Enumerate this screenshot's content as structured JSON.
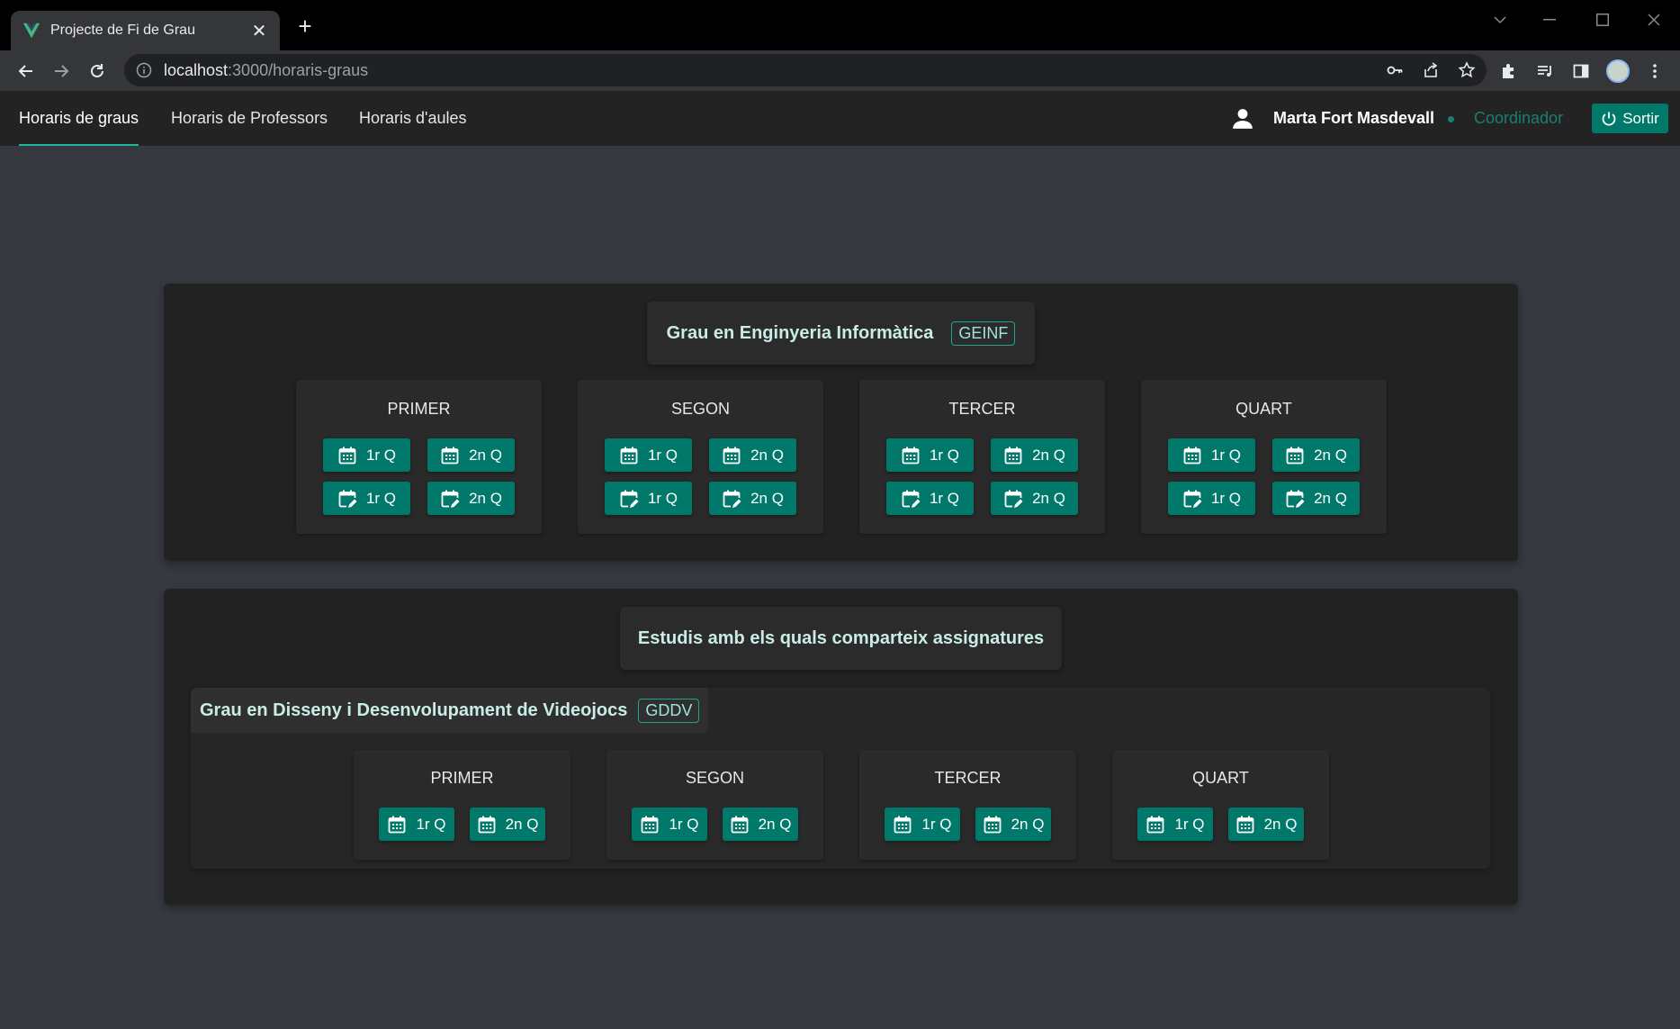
{
  "browser": {
    "tab_title": "Projecte de Fi de Grau",
    "url_host": "localhost",
    "url_path": ":3000/horaris-graus"
  },
  "nav": {
    "links": [
      "Horaris de graus",
      "Horaris de Professors",
      "Horaris d'aules"
    ],
    "user_name": "Marta Fort Masdevall",
    "role": "Coordinador",
    "logout_label": "Sortir"
  },
  "main_degree": {
    "title": "Grau en Enginyeria Informàtica",
    "code": "GEINF",
    "years": [
      {
        "name": "PRIMER",
        "view": [
          "1r Q",
          "2n Q"
        ],
        "edit": [
          "1r Q",
          "2n Q"
        ]
      },
      {
        "name": "SEGON",
        "view": [
          "1r Q",
          "2n Q"
        ],
        "edit": [
          "1r Q",
          "2n Q"
        ]
      },
      {
        "name": "TERCER",
        "view": [
          "1r Q",
          "2n Q"
        ],
        "edit": [
          "1r Q",
          "2n Q"
        ]
      },
      {
        "name": "QUART",
        "view": [
          "1r Q",
          "2n Q"
        ],
        "edit": [
          "1r Q",
          "2n Q"
        ]
      }
    ]
  },
  "shared": {
    "heading": "Estudis amb els quals comparteix assignatures",
    "degree_title": "Grau en Disseny i Desenvolupament de Videojocs",
    "degree_code": "GDDV",
    "years": [
      {
        "name": "PRIMER",
        "view": [
          "1r Q",
          "2n Q"
        ]
      },
      {
        "name": "SEGON",
        "view": [
          "1r Q",
          "2n Q"
        ]
      },
      {
        "name": "TERCER",
        "view": [
          "1r Q",
          "2n Q"
        ]
      },
      {
        "name": "QUART",
        "view": [
          "1r Q",
          "2n Q"
        ]
      }
    ]
  },
  "colors": {
    "accent": "#00796b",
    "accent_text": "#1b7f6f",
    "background": "#363a40",
    "panel": "#222222"
  }
}
